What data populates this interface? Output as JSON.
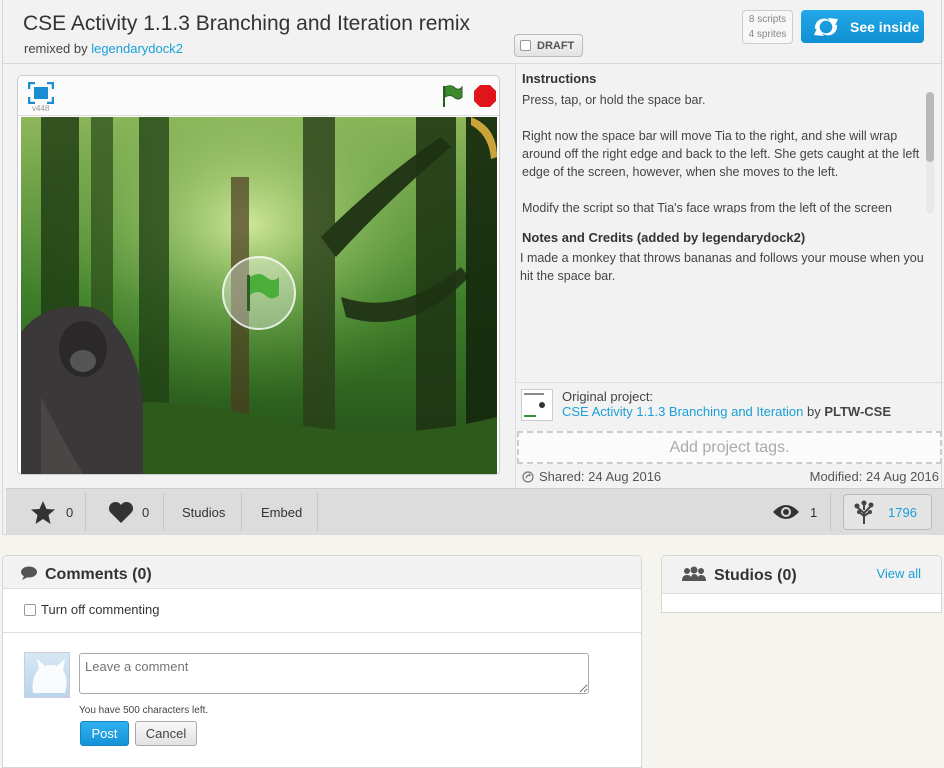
{
  "project": {
    "title": "CSE Activity 1.1.3 Branching and Iteration remix",
    "remixed_by_label": "remixed by",
    "remixed_by_user": "legendarydock2",
    "draft_label": "DRAFT",
    "scripts_count": "8 scripts",
    "sprites_count": "4 sprites",
    "see_inside_label": "See inside"
  },
  "player": {
    "version": "v448"
  },
  "instructions": {
    "heading": "Instructions",
    "paragraphs": [
      "Press, tap, or hold the space bar.",
      "Right now the space bar will move Tia to the right, and she will wrap around off the right edge and back to the left. She gets caught at the left edge of the screen, however, when she moves to the left.",
      "Modify the script so that Tia's face wraps from the left of the screen"
    ]
  },
  "notes": {
    "heading": "Notes and Credits (added by legendarydock2)",
    "text": "I made a monkey that throws bananas and follows your mouse when you hit the space bar."
  },
  "original": {
    "label": "Original project:",
    "project_link": "CSE Activity 1.1.3 Branching and Iteration",
    "by": "by",
    "author": "PLTW-CSE"
  },
  "tags_placeholder": "Add project tags.",
  "dates": {
    "shared": "Shared: 24 Aug 2016",
    "modified": "Modified: 24 Aug 2016"
  },
  "actions": {
    "favorites": "0",
    "loves": "0",
    "studios": "Studios",
    "embed": "Embed",
    "views": "1",
    "remixes": "1796"
  },
  "comments": {
    "title": "Comments (0)",
    "turn_off": "Turn off commenting",
    "placeholder": "Leave a comment",
    "chars_left": "You have 500 characters left.",
    "post": "Post",
    "cancel": "Cancel"
  },
  "studios_panel": {
    "title": "Studios (0)",
    "view_all": "View all"
  },
  "colors": {
    "accent_blue": "#1aa0d8",
    "stop_red": "#e0141b",
    "flag_green": "#2f7f2a"
  }
}
